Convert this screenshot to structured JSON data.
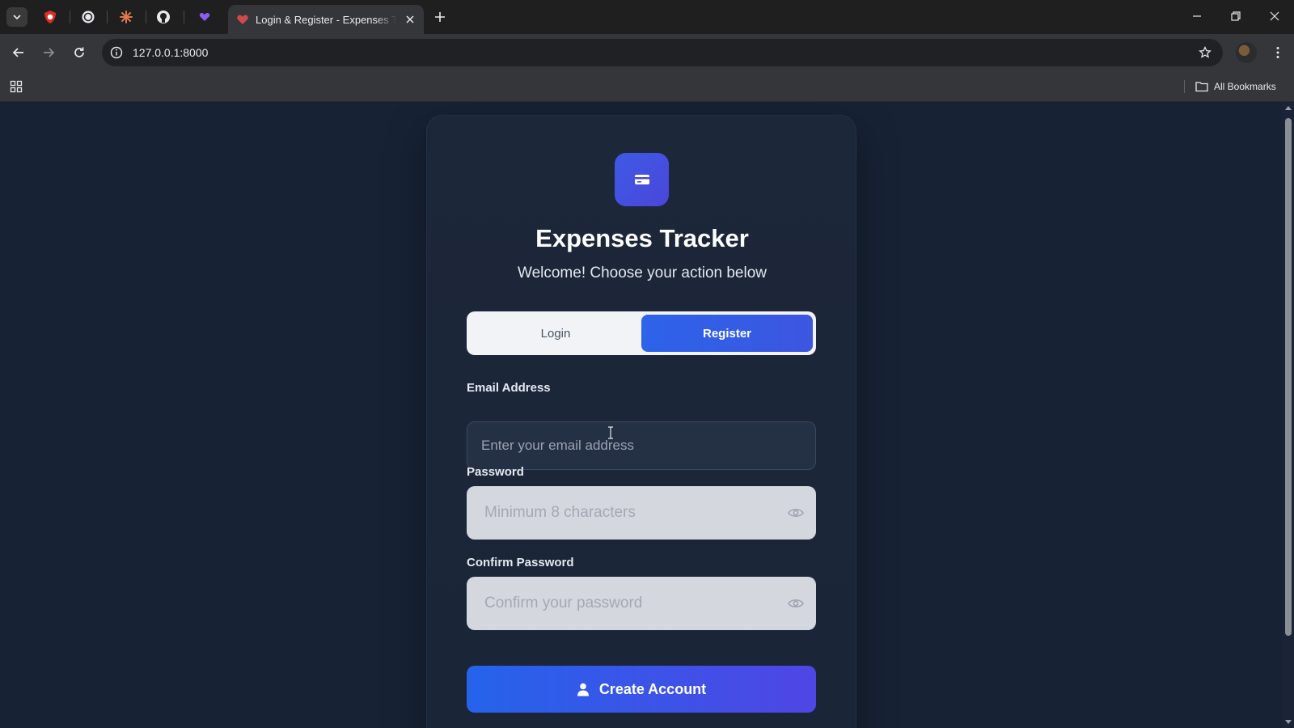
{
  "browser": {
    "active_tab_title": "Login & Register - Expenses Tracker",
    "url": "127.0.0.1:8000",
    "bookmarks_label": "All Bookmarks"
  },
  "page": {
    "app_title": "Expenses Tracker",
    "subtitle": "Welcome! Choose your action below",
    "tabs": [
      {
        "label": "Login",
        "active": false
      },
      {
        "label": "Register",
        "active": true
      }
    ],
    "email": {
      "label": "Email Address",
      "placeholder": "Enter your email address",
      "value": ""
    },
    "password": {
      "label": "Password",
      "placeholder": "Minimum 8 characters",
      "value": ""
    },
    "confirm_password": {
      "label": "Confirm Password",
      "placeholder": "Confirm your password",
      "value": ""
    },
    "submit_label": "Create Account"
  },
  "colors": {
    "page_background": "#172235",
    "card_background": "#1c2739",
    "accent_blue": "#2d63ea",
    "accent_indigo": "#4f46e5"
  },
  "icons": {
    "logo": "credit-card-icon",
    "password_toggle": "eye-icon",
    "submit": "user-icon"
  }
}
